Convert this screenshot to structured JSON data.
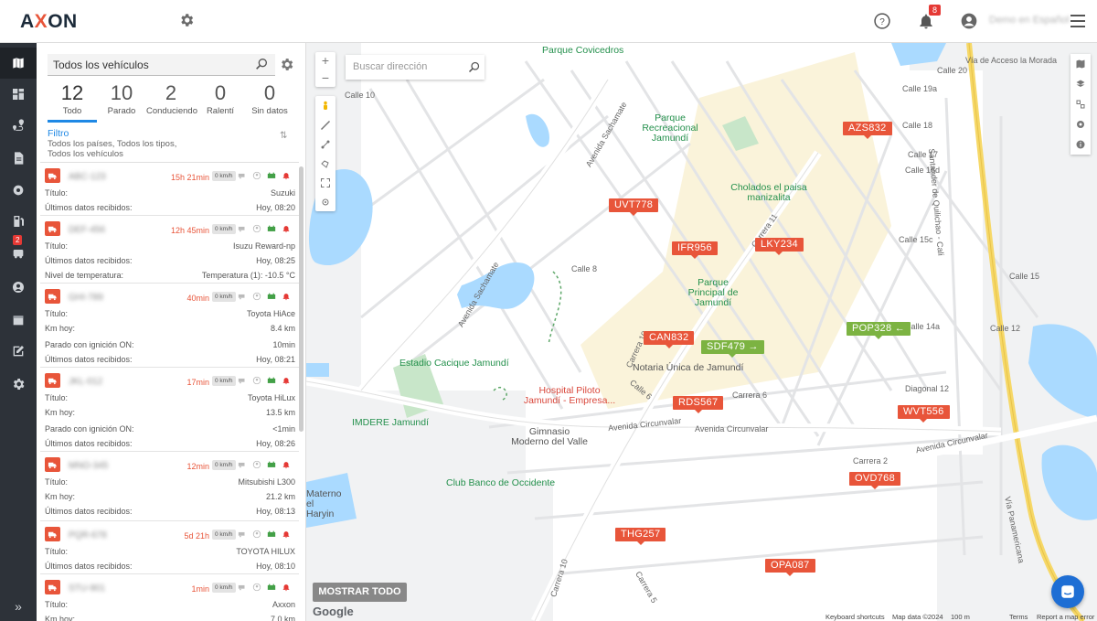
{
  "app": {
    "logo": "AXXON",
    "notifications_count": "8",
    "user_name": "Demo en Español"
  },
  "nav": {
    "badge": "2",
    "icons": [
      "map-icon",
      "dashboard-icon",
      "route-icon",
      "document-icon",
      "gear-icon",
      "fuel-icon",
      "vehicle-icon",
      "driver-icon",
      "calendar-icon",
      "edit-icon",
      "settings-icon"
    ],
    "expand": "»"
  },
  "panel": {
    "search_value": "Todos los vehículos",
    "stats": [
      {
        "num": "12",
        "label": "Todo"
      },
      {
        "num": "10",
        "label": "Parado"
      },
      {
        "num": "2",
        "label": "Conduciendo"
      },
      {
        "num": "0",
        "label": "Ralentí"
      },
      {
        "num": "0",
        "label": "Sin datos"
      }
    ],
    "filter_title": "Filtro",
    "filter_desc": "Todos los países, Todos los tipos, Todos los vehículos"
  },
  "vehicles": [
    {
      "plate": "ABC-123",
      "elapsed": "15h 21min",
      "speed": "0 km/h",
      "rows": [
        [
          "Título:",
          "Suzuki"
        ],
        [
          "Últimos datos recibidos:",
          "Hoy, 08:20"
        ]
      ]
    },
    {
      "plate": "DEF-456",
      "elapsed": "12h 45min",
      "speed": "0 km/h",
      "rows": [
        [
          "Título:",
          "Isuzu Reward-np"
        ],
        [
          "Últimos datos recibidos:",
          "Hoy, 08:25"
        ],
        [
          "Nivel de temperatura:",
          "Temperatura (1): -10.5 °C"
        ]
      ]
    },
    {
      "plate": "GHI-789",
      "elapsed": "40min",
      "speed": "0 km/h",
      "rows": [
        [
          "Título:",
          "Toyota HiAce"
        ],
        [
          "Km hoy:",
          "8.4 km"
        ],
        [
          "Parado con ignición ON:",
          "10min"
        ],
        [
          "Últimos datos recibidos:",
          "Hoy, 08:21"
        ]
      ]
    },
    {
      "plate": "JKL-012",
      "elapsed": "17min",
      "speed": "0 km/h",
      "rows": [
        [
          "Título:",
          "Toyota HiLux"
        ],
        [
          "Km hoy:",
          "13.5 km"
        ],
        [
          "Parado con ignición ON:",
          "<1min"
        ],
        [
          "Últimos datos recibidos:",
          "Hoy, 08:26"
        ]
      ]
    },
    {
      "plate": "MNO-345",
      "elapsed": "12min",
      "speed": "0 km/h",
      "rows": [
        [
          "Título:",
          "Mitsubishi L300"
        ],
        [
          "Km hoy:",
          "21.2 km"
        ],
        [
          "Últimos datos recibidos:",
          "Hoy, 08:13"
        ]
      ]
    },
    {
      "plate": "PQR-678",
      "elapsed": "5d 21h",
      "speed": "0 km/h",
      "rows": [
        [
          "Título:",
          "TOYOTA HILUX"
        ],
        [
          "Últimos datos recibidos:",
          "Hoy, 08:10"
        ]
      ]
    },
    {
      "plate": "STU-901",
      "elapsed": "1min",
      "speed": "0 km/h",
      "rows": [
        [
          "Título:",
          "Axxon"
        ],
        [
          "Km hoy:",
          "7.0 km"
        ]
      ]
    }
  ],
  "map": {
    "search_placeholder": "Buscar dirección",
    "show_all": "MOSTRAR TODO",
    "google": "Google",
    "markers": [
      {
        "label": "AZS832",
        "color": "red"
      },
      {
        "label": "UVT778",
        "color": "red"
      },
      {
        "label": "IFR956",
        "color": "red"
      },
      {
        "label": "LKY234",
        "color": "red"
      },
      {
        "label": "CAN832",
        "color": "red"
      },
      {
        "label": "SDF479",
        "color": "green",
        "arrow": "→"
      },
      {
        "label": "POP328",
        "color": "green",
        "arrow": "←"
      },
      {
        "label": "RDS567",
        "color": "red"
      },
      {
        "label": "WVT556",
        "color": "red"
      },
      {
        "label": "OVD768",
        "color": "red"
      },
      {
        "label": "THG257",
        "color": "red"
      },
      {
        "label": "OPA087",
        "color": "red"
      }
    ],
    "pois": {
      "parque_covicedros": "Parque Covicedros",
      "parque_recreacional": "Parque Recreacional Jamundí",
      "cholados": "Cholados el paisa manizalita",
      "parque_principal": "Parque Principal de Jamundí",
      "notaria": "Notaria Única de Jamundí",
      "estadio": "Estadio Cacique Jamundí",
      "hospital": "Hospital Piloto Jamundí - Empresa...",
      "imdere": "IMDERE Jamundí",
      "gimnasio": "Gimnasio Moderno del Valle",
      "club": "Club Banco de Occidente",
      "materno": "Materno el Haryin"
    },
    "streets": {
      "via_acceso": "Vía de Acceso la Morada",
      "santander": "Santander de Quilichao - Cali",
      "panamericana": "Vía Panamericana",
      "av_circunvalar_1": "Avenida Circunvalar",
      "av_circunvalar_2": "Avenida Circunvalar",
      "av_circunvalar_3": "Avenida Circunvalar",
      "av_sachamate_1": "Avenida Sachamate",
      "av_sachamate_2": "Avenida Sachamate",
      "diagonal_12": "Diagonal 12",
      "carrera_10a": "Carrera 10",
      "carrera_10b": "Carrera 10",
      "carrera_11": "Carrera 11",
      "calle_20": "Calle 20",
      "calle_19a": "Calle 19a",
      "calle_18": "Calle 18",
      "calle_17": "Calle 17",
      "calle_16d": "Calle 16d",
      "calle_15c": "Calle 15c",
      "calle_14a": "Calle 14a",
      "calle_12": "Calle 12",
      "calle_10": "Calle 10",
      "calle_8": "Calle 8",
      "calle_6": "Calle 6",
      "carrera_2": "Carrera 2",
      "carrera_5": "Carrera 5",
      "carrera_6": "Carrera 6",
      "calle_15": "Calle 15"
    },
    "attribution": {
      "shortcuts": "Keyboard shortcuts",
      "data": "Map data ©2024",
      "scale": "100 m",
      "terms": "Terms",
      "report": "Report a map error"
    }
  }
}
